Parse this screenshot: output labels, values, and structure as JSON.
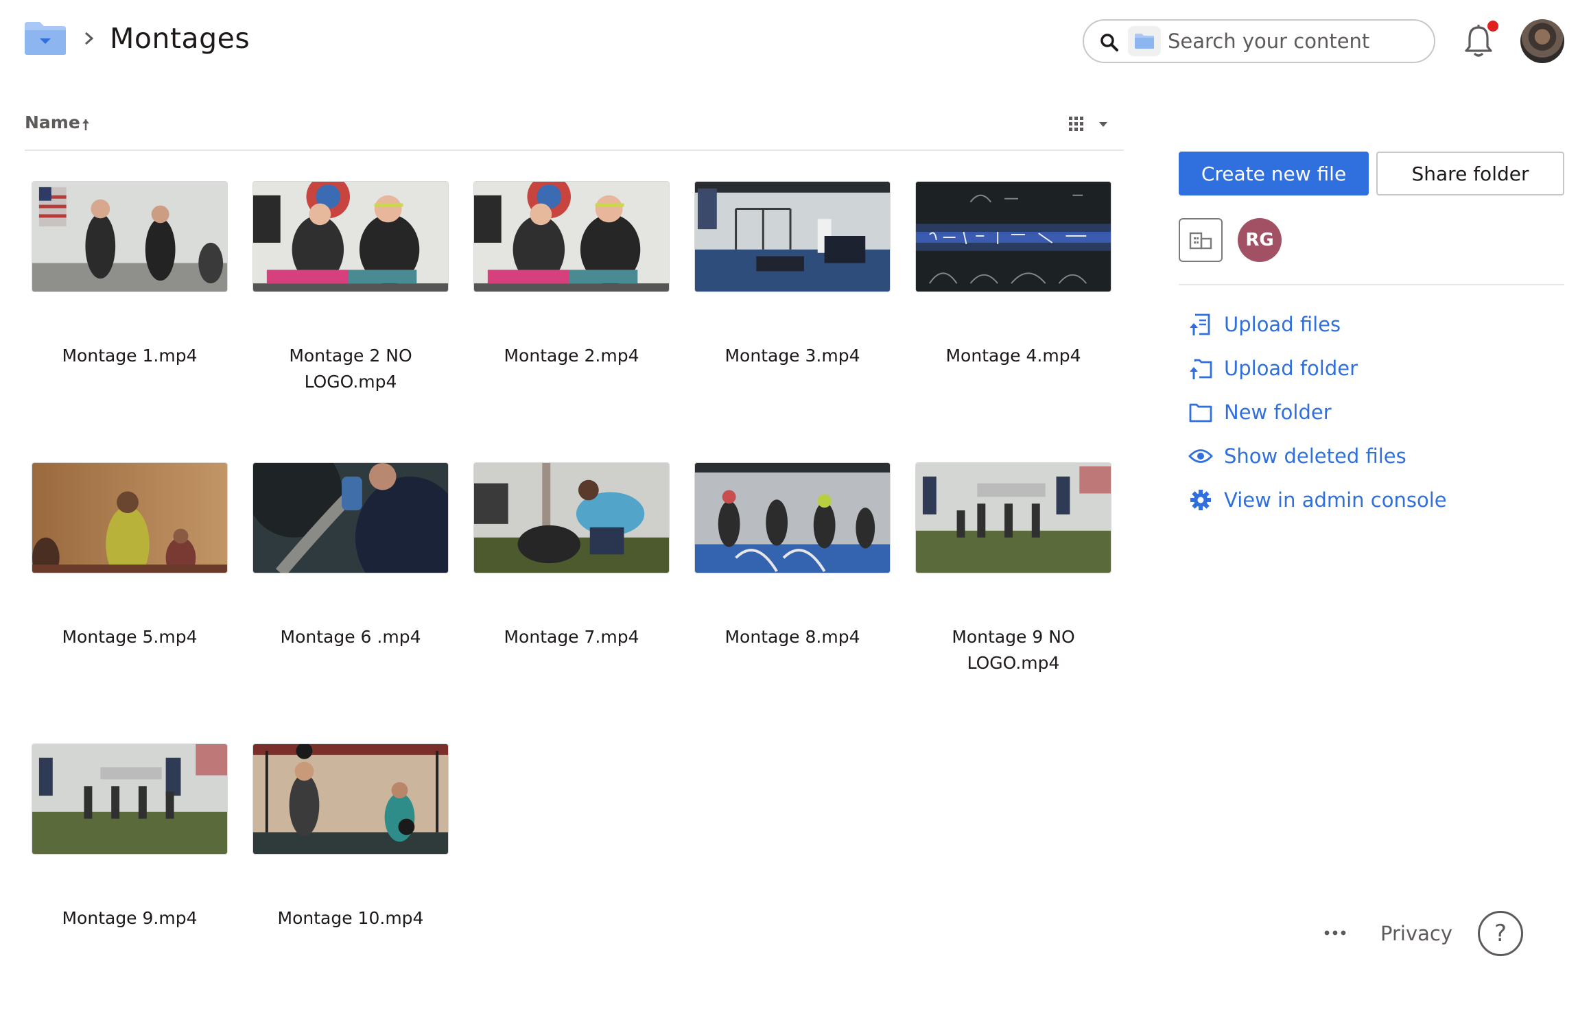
{
  "header": {
    "title": "Montages",
    "search_placeholder": "Search your content",
    "notification_dot": true
  },
  "list": {
    "sort_label": "Name",
    "sort_direction": "ascending"
  },
  "files": [
    {
      "name": "Montage 1.mp4"
    },
    {
      "name": "Montage 2 NO LOGO.mp4"
    },
    {
      "name": "Montage 2.mp4"
    },
    {
      "name": "Montage 3.mp4"
    },
    {
      "name": "Montage 4.mp4"
    },
    {
      "name": "Montage 5.mp4"
    },
    {
      "name": "Montage 6 .mp4"
    },
    {
      "name": "Montage 7.mp4"
    },
    {
      "name": "Montage 8.mp4"
    },
    {
      "name": "Montage 9 NO LOGO.mp4"
    },
    {
      "name": "Montage 9.mp4"
    },
    {
      "name": "Montage 10.mp4"
    }
  ],
  "panel": {
    "create_label": "Create new file",
    "share_label": "Share folder",
    "member_initials": "RG",
    "actions": [
      {
        "label": "Upload files",
        "icon": "upload-file-icon"
      },
      {
        "label": "Upload folder",
        "icon": "upload-folder-icon"
      },
      {
        "label": "New folder",
        "icon": "folder-icon"
      },
      {
        "label": "Show deleted files",
        "icon": "eye-icon"
      },
      {
        "label": "View in admin console",
        "icon": "gear-icon"
      }
    ]
  },
  "footer": {
    "more": "•••",
    "privacy": "Privacy",
    "help": "?"
  },
  "colors": {
    "accent": "#2f6fde",
    "folder": "#a9c8f5",
    "avatar_rg": "#a25063",
    "notification": "#e01f1f"
  }
}
